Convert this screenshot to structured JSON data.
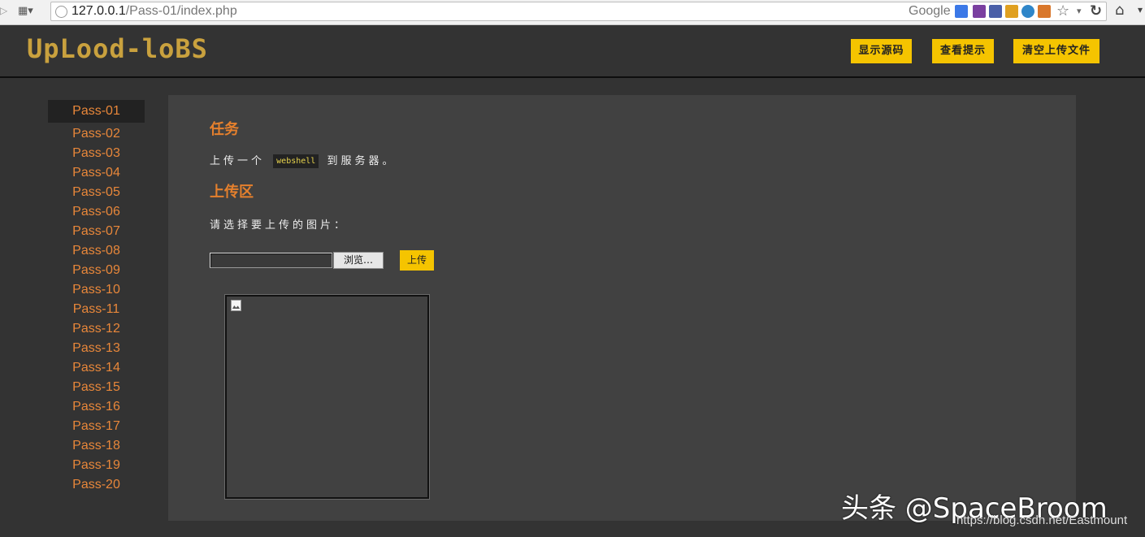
{
  "browser": {
    "url_host": "127.0.0.1",
    "url_path": "/Pass-01/index.php",
    "search_engine": "Google",
    "icons": [
      "apps-grid-icon",
      "globe-icon",
      "google-search-icon",
      "bookmark-star-icon",
      "reload-icon",
      "home-icon"
    ]
  },
  "header": {
    "logo_text": "UpLood-loBS",
    "buttons": {
      "show_source": "显示源码",
      "view_hint": "查看提示",
      "clear_uploads": "清空上传文件"
    }
  },
  "sidebar": {
    "items": [
      {
        "label": "Pass-01",
        "active": true
      },
      {
        "label": "Pass-02"
      },
      {
        "label": "Pass-03"
      },
      {
        "label": "Pass-04"
      },
      {
        "label": "Pass-05"
      },
      {
        "label": "Pass-06"
      },
      {
        "label": "Pass-07"
      },
      {
        "label": "Pass-08"
      },
      {
        "label": "Pass-09"
      },
      {
        "label": "Pass-10"
      },
      {
        "label": "Pass-11"
      },
      {
        "label": "Pass-12"
      },
      {
        "label": "Pass-13"
      },
      {
        "label": "Pass-14"
      },
      {
        "label": "Pass-15"
      },
      {
        "label": "Pass-16"
      },
      {
        "label": "Pass-17"
      },
      {
        "label": "Pass-18"
      },
      {
        "label": "Pass-19"
      },
      {
        "label": "Pass-20"
      }
    ]
  },
  "main": {
    "task_title": "任务",
    "task_prefix": "上传一个",
    "task_code": "webshell",
    "task_suffix": "到服务器。",
    "upload_title": "上传区",
    "upload_prompt": "请选择要上传的图片：",
    "browse_label": "浏览…",
    "upload_label": "上传"
  },
  "watermark": {
    "main": "头条 @SpaceBroom",
    "sub": "https://blog.csdn.net/Eastmount"
  },
  "colors": {
    "accent_orange": "#e5802d",
    "button_yellow": "#f5c400",
    "page_bg": "#333333",
    "panel_bg": "#414141"
  }
}
